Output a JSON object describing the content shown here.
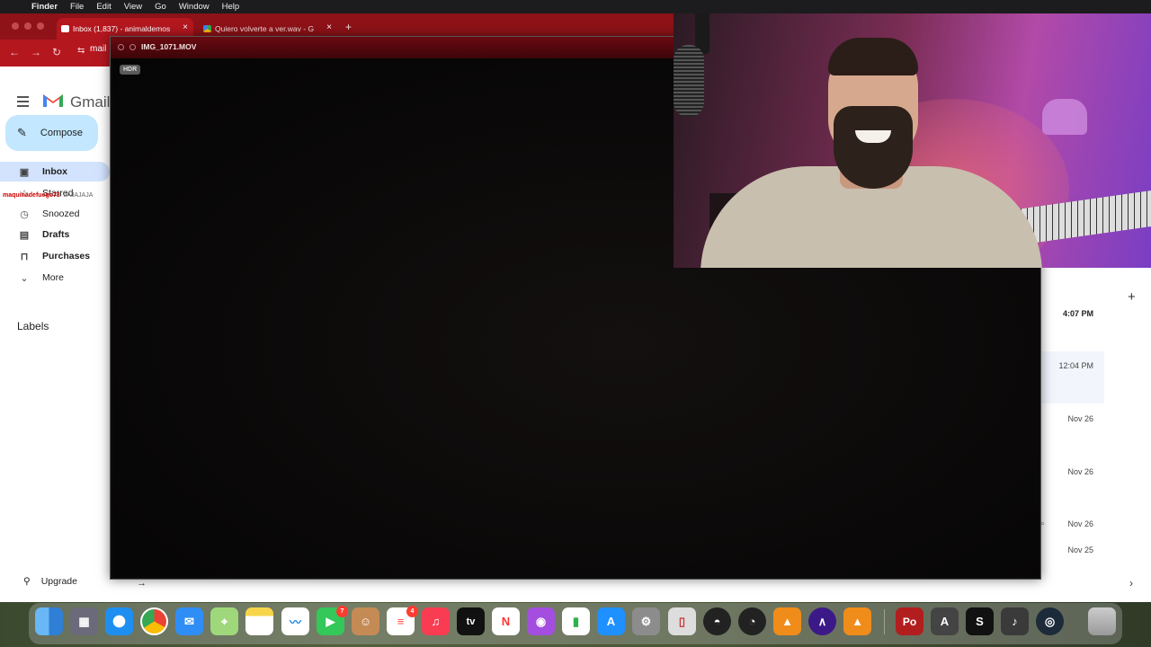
{
  "menubar": {
    "app": "Finder",
    "items": [
      "File",
      "Edit",
      "View",
      "Go",
      "Window",
      "Help"
    ]
  },
  "browser": {
    "tabs": [
      {
        "title": "Inbox (1,837) - animaldemos",
        "close": "×"
      },
      {
        "title": "Quiero volverte a ver.wav - G",
        "close": "×"
      }
    ],
    "new_tab": "+",
    "address": "mail"
  },
  "gmail": {
    "brand": "Gmail",
    "compose": "Compose",
    "nav": [
      {
        "label": "Inbox",
        "icon": "inbox-icon"
      },
      {
        "label": "Starred",
        "icon": "star-icon"
      },
      {
        "label": "Snoozed",
        "icon": "clock-icon"
      },
      {
        "label": "Drafts",
        "icon": "draft-icon"
      },
      {
        "label": "Purchases",
        "icon": "bag-icon"
      },
      {
        "label": "More",
        "icon": "chevron-down-icon"
      }
    ],
    "labels_heading": "Labels",
    "upgrade": "Upgrade",
    "overlay_username": "maquinadefuego73",
    "overlay_suffix": ": JAJAJAJA",
    "times": [
      "4:07 PM",
      "12:04 PM",
      "Nov 26",
      "Nov 26",
      "Nov 26",
      "Nov 25"
    ]
  },
  "quicktime": {
    "title": "IMG_1071.MOV",
    "badge": "HDR"
  },
  "dock": {
    "badges": {
      "facetime": "7",
      "reminders": "4"
    },
    "apple_tv": "tv",
    "pro_tools": "Po"
  }
}
